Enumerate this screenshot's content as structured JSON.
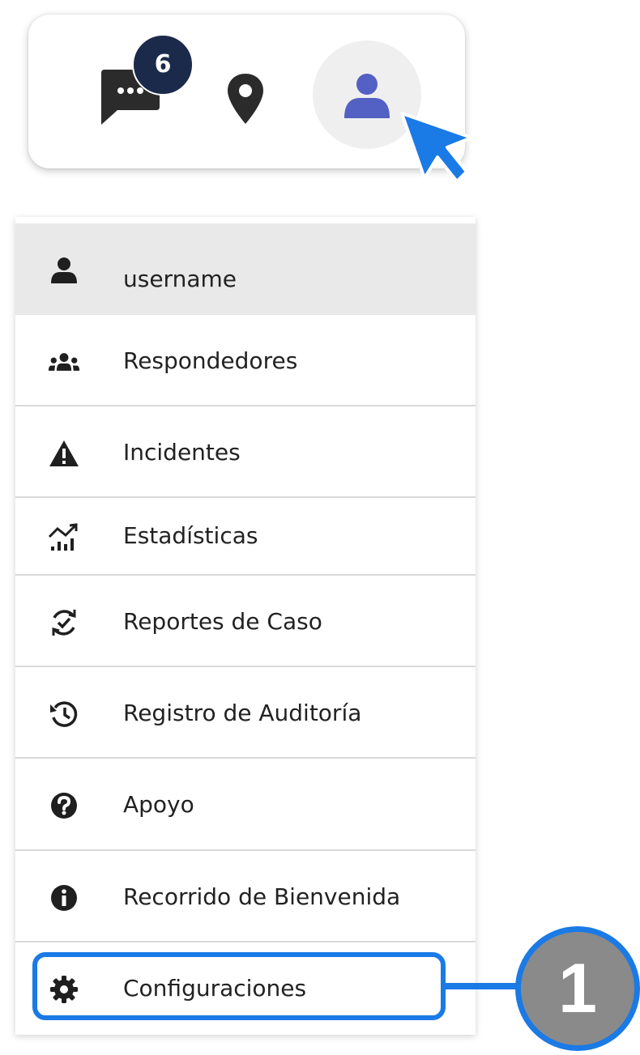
{
  "topbar": {
    "chat": {
      "icon": "chat-dots-icon",
      "unread_count": "6",
      "badge_color": "#1b2a4a"
    },
    "location": {
      "icon": "map-pin-icon"
    },
    "profile": {
      "icon": "user-icon",
      "icon_color": "#5360c4"
    }
  },
  "menu": {
    "items": [
      {
        "id": "username",
        "icon": "user-icon",
        "label": "username",
        "selected": true
      },
      {
        "id": "responders",
        "icon": "users-group-icon",
        "label": "Respondedores"
      },
      {
        "id": "incidents",
        "icon": "warning-triangle-icon",
        "label": "Incidentes"
      },
      {
        "id": "statistics",
        "icon": "chart-growth-icon",
        "label": " Estadísticas"
      },
      {
        "id": "case-reports",
        "icon": "sync-check-icon",
        "label": "Reportes de Caso"
      },
      {
        "id": "audit-log",
        "icon": "history-icon",
        "label": "Registro de Auditoría"
      },
      {
        "id": "support",
        "icon": "question-circle-icon",
        "label": "Apoyo"
      },
      {
        "id": "welcome-tour",
        "icon": "info-circle-icon",
        "label": "Recorrido de Bienvenida"
      },
      {
        "id": "settings",
        "icon": "gear-icon",
        "label": "Configuraciones",
        "highlighted": true
      }
    ]
  },
  "callout": {
    "step_number": "1",
    "accent_color": "#1a7ae6"
  }
}
